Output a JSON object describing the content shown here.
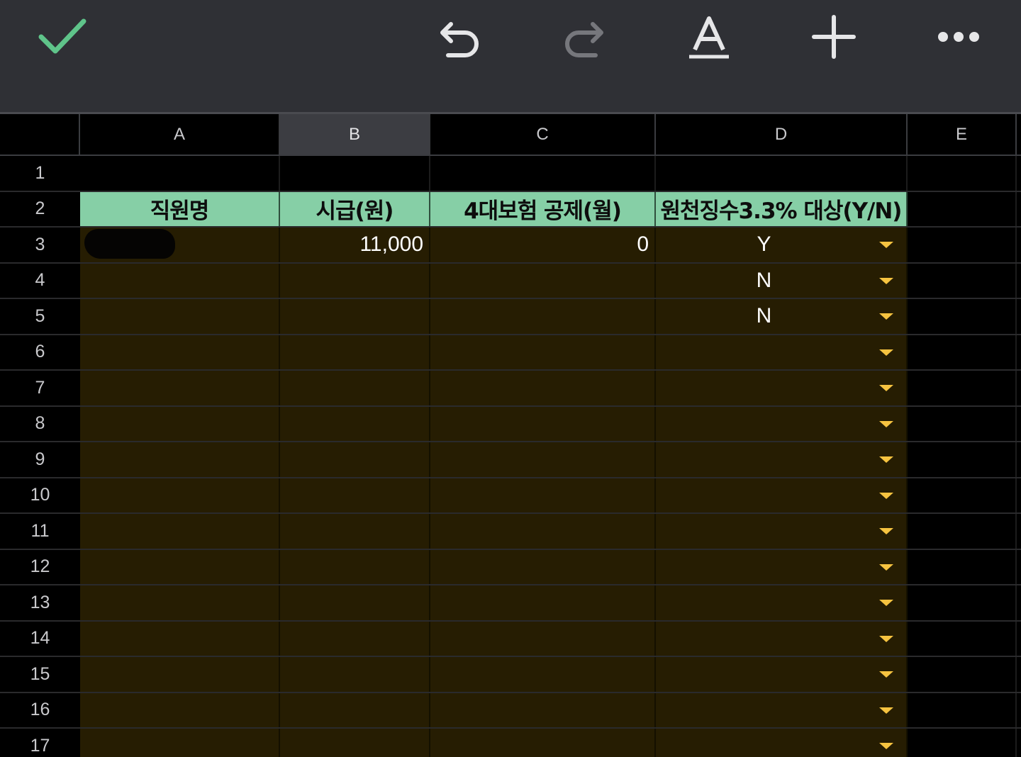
{
  "toolbar": {
    "done": "checkmark-icon",
    "undo": "undo-icon",
    "redo": "redo-icon",
    "format": "text-format-icon",
    "insert": "plus-icon",
    "more": "more-icon",
    "accent_color": "#5fc48a"
  },
  "columns": [
    "A",
    "B",
    "C",
    "D",
    "E"
  ],
  "selected_column": "B",
  "rows": [
    "1",
    "2",
    "3",
    "4",
    "5",
    "6",
    "7",
    "8",
    "9",
    "10",
    "11",
    "12",
    "13",
    "14",
    "15",
    "16",
    "17"
  ],
  "table": {
    "headers": {
      "name": "직원명",
      "wage": "시급(원)",
      "insurance": "4대보험 공제(월)",
      "withholding": "원천징수3.3% 대상(Y/N)"
    },
    "records": [
      {
        "name": "",
        "wage": "11,000",
        "insurance": "0",
        "withholding": "Y"
      },
      {
        "name": "",
        "wage": "",
        "insurance": "",
        "withholding": "N"
      },
      {
        "name": "",
        "wage": "",
        "insurance": "",
        "withholding": "N"
      },
      {
        "name": "",
        "wage": "",
        "insurance": "",
        "withholding": ""
      },
      {
        "name": "",
        "wage": "",
        "insurance": "",
        "withholding": ""
      },
      {
        "name": "",
        "wage": "",
        "insurance": "",
        "withholding": ""
      },
      {
        "name": "",
        "wage": "",
        "insurance": "",
        "withholding": ""
      },
      {
        "name": "",
        "wage": "",
        "insurance": "",
        "withholding": ""
      },
      {
        "name": "",
        "wage": "",
        "insurance": "",
        "withholding": ""
      },
      {
        "name": "",
        "wage": "",
        "insurance": "",
        "withholding": ""
      },
      {
        "name": "",
        "wage": "",
        "insurance": "",
        "withholding": ""
      },
      {
        "name": "",
        "wage": "",
        "insurance": "",
        "withholding": ""
      },
      {
        "name": "",
        "wage": "",
        "insurance": "",
        "withholding": ""
      },
      {
        "name": "",
        "wage": "",
        "insurance": "",
        "withholding": ""
      },
      {
        "name": "",
        "wage": "",
        "insurance": "",
        "withholding": ""
      }
    ]
  },
  "colors": {
    "header_fill": "#86cfa6",
    "data_fill": "#261d02",
    "dropdown_arrow": "#f6c340",
    "toolbar_bg": "#2f3035"
  }
}
